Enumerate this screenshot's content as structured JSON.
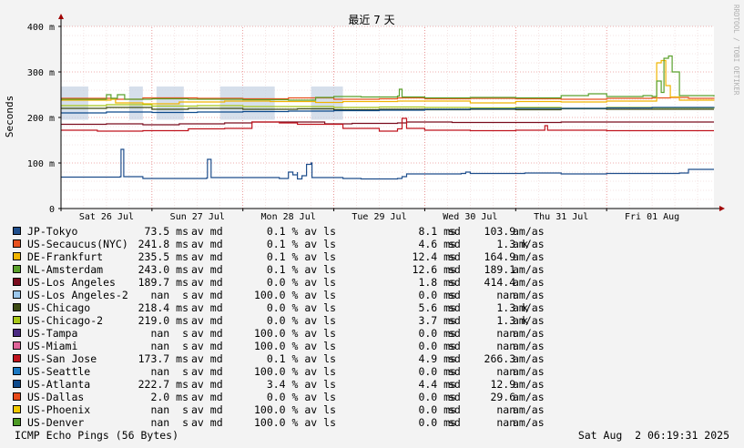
{
  "chart_data": {
    "type": "line",
    "title": "最近 7 天",
    "ylabel": "Seconds",
    "ylim": [
      0,
      400
    ],
    "ytick_labels": [
      {
        "value": 0,
        "label": "0"
      },
      {
        "value": 100,
        "label": "100 m"
      },
      {
        "value": 200,
        "label": "200 m"
      },
      {
        "value": 300,
        "label": "300 m"
      },
      {
        "value": 400,
        "label": "400 m"
      }
    ],
    "x_range": [
      0,
      7.18
    ],
    "xtick_labels": [
      {
        "value": 0,
        "label": "Sat 26 Jul"
      },
      {
        "value": 1,
        "label": "Sun 27 Jul"
      },
      {
        "value": 2,
        "label": "Mon 28 Jul"
      },
      {
        "value": 3,
        "label": "Tue 29 Jul"
      },
      {
        "value": 4,
        "label": "Wed 30 Jul"
      },
      {
        "value": 5,
        "label": "Thu 31 Jul"
      },
      {
        "value": 6,
        "label": "Fri 01 Aug"
      }
    ],
    "watermark": "RRDTOOL / TOBI OETIKER",
    "grid": true,
    "series": [
      {
        "name": "JP-Tokyo",
        "color": "#1f4e8c",
        "values": [
          [
            0,
            69
          ],
          [
            0.65,
            70
          ],
          [
            0.66,
            130
          ],
          [
            0.68,
            130
          ],
          [
            0.69,
            70
          ],
          [
            0.9,
            66
          ],
          [
            1.6,
            67
          ],
          [
            1.61,
            108
          ],
          [
            1.64,
            108
          ],
          [
            1.65,
            68
          ],
          [
            2.4,
            66
          ],
          [
            2.5,
            80
          ],
          [
            2.55,
            74
          ],
          [
            2.6,
            80
          ],
          [
            2.6,
            65
          ],
          [
            2.65,
            72
          ],
          [
            2.7,
            97
          ],
          [
            2.75,
            100
          ],
          [
            2.76,
            68
          ],
          [
            3.1,
            66
          ],
          [
            3.3,
            65
          ],
          [
            3.7,
            66
          ],
          [
            3.75,
            70
          ],
          [
            3.8,
            76
          ],
          [
            4.2,
            76
          ],
          [
            4.4,
            77
          ],
          [
            4.45,
            80
          ],
          [
            4.5,
            77
          ],
          [
            5,
            77
          ],
          [
            5.1,
            78
          ],
          [
            5.5,
            76
          ],
          [
            6,
            77
          ],
          [
            6.8,
            78
          ],
          [
            6.9,
            86
          ],
          [
            7.18,
            86
          ]
        ]
      },
      {
        "name": "US-Secaucus(NYC)",
        "color": "#e8521f",
        "values": [
          [
            0,
            242
          ],
          [
            0.6,
            240
          ],
          [
            0.9,
            243
          ],
          [
            1.5,
            242
          ],
          [
            2,
            241
          ],
          [
            2.5,
            243
          ],
          [
            3,
            240
          ],
          [
            3.5,
            241
          ],
          [
            3.7,
            243
          ],
          [
            4,
            241
          ],
          [
            4.5,
            242
          ],
          [
            5,
            241
          ],
          [
            5.5,
            240
          ],
          [
            6,
            242
          ],
          [
            6.5,
            243
          ],
          [
            6.7,
            244
          ],
          [
            6.9,
            242
          ],
          [
            7.18,
            241
          ]
        ]
      },
      {
        "name": "DE-Frankfurt",
        "color": "#f0b400",
        "values": [
          [
            0,
            238
          ],
          [
            0.55,
            240
          ],
          [
            0.6,
            232
          ],
          [
            0.9,
            230
          ],
          [
            1.3,
            234
          ],
          [
            1.8,
            236
          ],
          [
            2.3,
            235
          ],
          [
            2.8,
            233
          ],
          [
            3.1,
            235
          ],
          [
            3.7,
            236
          ],
          [
            4.5,
            232
          ],
          [
            5,
            235
          ],
          [
            5.5,
            234
          ],
          [
            6,
            236
          ],
          [
            6.5,
            236
          ],
          [
            6.55,
            320
          ],
          [
            6.6,
            325
          ],
          [
            6.65,
            270
          ],
          [
            6.7,
            245
          ],
          [
            6.8,
            238
          ],
          [
            7.18,
            237
          ]
        ]
      },
      {
        "name": "NL-Amsterdam",
        "color": "#5aa02c",
        "values": [
          [
            0,
            240
          ],
          [
            0.5,
            250
          ],
          [
            0.55,
            242
          ],
          [
            0.62,
            250
          ],
          [
            0.7,
            240
          ],
          [
            1,
            241
          ],
          [
            1.4,
            240
          ],
          [
            2,
            239
          ],
          [
            2.5,
            238
          ],
          [
            2.8,
            244
          ],
          [
            3,
            246
          ],
          [
            3.3,
            245
          ],
          [
            3.7,
            247
          ],
          [
            3.72,
            262
          ],
          [
            3.75,
            245
          ],
          [
            4,
            243
          ],
          [
            4.5,
            244
          ],
          [
            5,
            243
          ],
          [
            5.5,
            248
          ],
          [
            5.8,
            252
          ],
          [
            6,
            246
          ],
          [
            6.4,
            248
          ],
          [
            6.5,
            246
          ],
          [
            6.55,
            280
          ],
          [
            6.6,
            255
          ],
          [
            6.63,
            330
          ],
          [
            6.68,
            335
          ],
          [
            6.72,
            300
          ],
          [
            6.8,
            248
          ],
          [
            7.18,
            246
          ]
        ]
      },
      {
        "name": "US-Los Angeles",
        "color": "#7a0c1e",
        "values": [
          [
            0,
            185
          ],
          [
            0.5,
            186
          ],
          [
            0.9,
            184
          ],
          [
            1.3,
            186
          ],
          [
            1.8,
            188
          ],
          [
            2.1,
            190
          ],
          [
            2.5,
            190
          ],
          [
            2.9,
            186
          ],
          [
            3.2,
            187
          ],
          [
            3.7,
            188
          ],
          [
            3.8,
            190
          ],
          [
            4.3,
            189
          ],
          [
            5,
            189
          ],
          [
            5.5,
            190
          ],
          [
            6,
            190
          ],
          [
            6.5,
            190
          ],
          [
            7.18,
            190
          ]
        ]
      },
      {
        "name": "US-Los Angeles-2",
        "color": "#9cc8ec",
        "values": []
      },
      {
        "name": "US-Chicago",
        "color": "#3c4a14",
        "values": [
          [
            0,
            220
          ],
          [
            0.5,
            222
          ],
          [
            1,
            218
          ],
          [
            1.4,
            220
          ],
          [
            2,
            218
          ],
          [
            2.6,
            219
          ],
          [
            3,
            217
          ],
          [
            3.5,
            218
          ],
          [
            4,
            217
          ],
          [
            4.5,
            218
          ],
          [
            5,
            217
          ],
          [
            5.5,
            219
          ],
          [
            6,
            218
          ],
          [
            6.5,
            218
          ],
          [
            7.18,
            218
          ]
        ]
      },
      {
        "name": "US-Chicago-2",
        "color": "#a8c81a",
        "values": [
          [
            0,
            226
          ],
          [
            0.5,
            228
          ],
          [
            1,
            225
          ],
          [
            1.5,
            226
          ],
          [
            2,
            224
          ],
          [
            2.5,
            224
          ],
          [
            3,
            222
          ],
          [
            3.5,
            223
          ],
          [
            4,
            222
          ],
          [
            4.5,
            221
          ],
          [
            5,
            222
          ],
          [
            5.5,
            220
          ],
          [
            6,
            222
          ],
          [
            6.5,
            221
          ],
          [
            7.18,
            222
          ]
        ]
      },
      {
        "name": "US-Tampa",
        "color": "#4b2a82",
        "values": []
      },
      {
        "name": "US-Miami",
        "color": "#e0649a",
        "values": []
      },
      {
        "name": "US-San Jose",
        "color": "#c0141e",
        "values": [
          [
            0,
            172
          ],
          [
            0.4,
            170
          ],
          [
            0.9,
            171
          ],
          [
            1.4,
            175
          ],
          [
            1.8,
            176
          ],
          [
            2,
            176
          ],
          [
            2.1,
            190
          ],
          [
            2.4,
            188
          ],
          [
            2.6,
            185
          ],
          [
            3.1,
            176
          ],
          [
            3.5,
            170
          ],
          [
            3.7,
            175
          ],
          [
            3.75,
            198
          ],
          [
            3.8,
            176
          ],
          [
            4,
            172
          ],
          [
            4.5,
            171
          ],
          [
            5,
            172
          ],
          [
            5.3,
            172
          ],
          [
            5.32,
            182
          ],
          [
            5.35,
            172
          ],
          [
            5.5,
            172
          ],
          [
            6,
            171
          ],
          [
            7.18,
            171
          ]
        ]
      },
      {
        "name": "US-Seattle",
        "color": "#1a78c2",
        "values": []
      },
      {
        "name": "US-Atlanta",
        "color": "#0e4a8c",
        "values": [
          [
            0,
            210
          ],
          [
            0.5,
            212
          ],
          [
            1,
            211
          ],
          [
            1.5,
            212
          ],
          [
            2,
            213
          ],
          [
            2.5,
            214
          ],
          [
            3,
            215
          ],
          [
            3.5,
            216
          ],
          [
            4,
            218
          ],
          [
            4.5,
            219
          ],
          [
            5,
            220
          ],
          [
            5.5,
            220
          ],
          [
            6,
            221
          ],
          [
            6.5,
            222
          ],
          [
            7.18,
            223
          ]
        ]
      },
      {
        "name": "US-Dallas",
        "color": "#e84a1a",
        "values": []
      },
      {
        "name": "US-Phoenix",
        "color": "#f0c800",
        "values": []
      },
      {
        "name": "US-Denver",
        "color": "#4c9a24",
        "values": []
      }
    ]
  },
  "legend": [
    {
      "name": "JP-Tokyo",
      "color": "#1f4e8c",
      "avg": "73.5",
      "avg_unit": "ms",
      "loss": "0.1",
      "stdev": "8.1",
      "stdev_unit": "ms",
      "ratio": "103.9",
      "ratio_unit": ""
    },
    {
      "name": "US-Secaucus(NYC)",
      "color": "#e8521f",
      "avg": "241.8",
      "avg_unit": "ms",
      "loss": "0.1",
      "stdev": "4.6",
      "stdev_unit": "ms",
      "ratio": "1.3",
      "ratio_unit": "k"
    },
    {
      "name": "DE-Frankfurt",
      "color": "#f0b400",
      "avg": "235.5",
      "avg_unit": "ms",
      "loss": "0.1",
      "stdev": "12.4",
      "stdev_unit": "ms",
      "ratio": "164.9",
      "ratio_unit": ""
    },
    {
      "name": "NL-Amsterdam",
      "color": "#5aa02c",
      "avg": "243.0",
      "avg_unit": "ms",
      "loss": "0.1",
      "stdev": "12.6",
      "stdev_unit": "ms",
      "ratio": "189.1",
      "ratio_unit": ""
    },
    {
      "name": "US-Los Angeles",
      "color": "#7a0c1e",
      "avg": "189.7",
      "avg_unit": "ms",
      "loss": "0.0",
      "stdev": "1.8",
      "stdev_unit": "ms",
      "ratio": "414.4",
      "ratio_unit": ""
    },
    {
      "name": "US-Los Angeles-2",
      "color": "#9cc8ec",
      "avg": "nan",
      "avg_unit": " s",
      "loss": "100.0",
      "stdev": "0.0",
      "stdev_unit": "ms",
      "ratio": "nan",
      "ratio_unit": ""
    },
    {
      "name": "US-Chicago",
      "color": "#3c4a14",
      "avg": "218.4",
      "avg_unit": "ms",
      "loss": "0.0",
      "stdev": "5.6",
      "stdev_unit": "ms",
      "ratio": "1.3",
      "ratio_unit": "k"
    },
    {
      "name": "US-Chicago-2",
      "color": "#a8c81a",
      "avg": "219.0",
      "avg_unit": "ms",
      "loss": "0.0",
      "stdev": "3.7",
      "stdev_unit": "ms",
      "ratio": "1.3",
      "ratio_unit": "k"
    },
    {
      "name": "US-Tampa",
      "color": "#4b2a82",
      "avg": "nan",
      "avg_unit": " s",
      "loss": "100.0",
      "stdev": "0.0",
      "stdev_unit": "ms",
      "ratio": "nan",
      "ratio_unit": ""
    },
    {
      "name": "US-Miami",
      "color": "#e0649a",
      "avg": "nan",
      "avg_unit": " s",
      "loss": "100.0",
      "stdev": "0.0",
      "stdev_unit": "ms",
      "ratio": "nan",
      "ratio_unit": ""
    },
    {
      "name": "US-San Jose",
      "color": "#c0141e",
      "avg": "173.7",
      "avg_unit": "ms",
      "loss": "0.1",
      "stdev": "4.9",
      "stdev_unit": "ms",
      "ratio": "266.3",
      "ratio_unit": ""
    },
    {
      "name": "US-Seattle",
      "color": "#1a78c2",
      "avg": "nan",
      "avg_unit": " s",
      "loss": "100.0",
      "stdev": "0.0",
      "stdev_unit": "ms",
      "ratio": "nan",
      "ratio_unit": ""
    },
    {
      "name": "US-Atlanta",
      "color": "#0e4a8c",
      "avg": "222.7",
      "avg_unit": "ms",
      "loss": "3.4",
      "stdev": "4.4",
      "stdev_unit": "ms",
      "ratio": "12.9",
      "ratio_unit": ""
    },
    {
      "name": "US-Dallas",
      "color": "#e84a1a",
      "avg": "2.0",
      "avg_unit": "ms",
      "loss": "0.0",
      "stdev": "0.0",
      "stdev_unit": "ms",
      "ratio": "29.6",
      "ratio_unit": ""
    },
    {
      "name": "US-Phoenix",
      "color": "#f0c800",
      "avg": "nan",
      "avg_unit": " s",
      "loss": "100.0",
      "stdev": "0.0",
      "stdev_unit": "ms",
      "ratio": "nan",
      "ratio_unit": ""
    },
    {
      "name": "US-Denver",
      "color": "#4c9a24",
      "avg": "nan",
      "avg_unit": " s",
      "loss": "100.0",
      "stdev": "0.0",
      "stdev_unit": "ms",
      "ratio": "nan",
      "ratio_unit": ""
    }
  ],
  "legend_labels": {
    "avg": "av md",
    "loss": "% av ls",
    "stdev": "sd",
    "ratio": "am/as"
  },
  "footer": {
    "left": "ICMP Echo Pings (56 Bytes)",
    "right": "Sat Aug  2 06:19:31 2025"
  }
}
